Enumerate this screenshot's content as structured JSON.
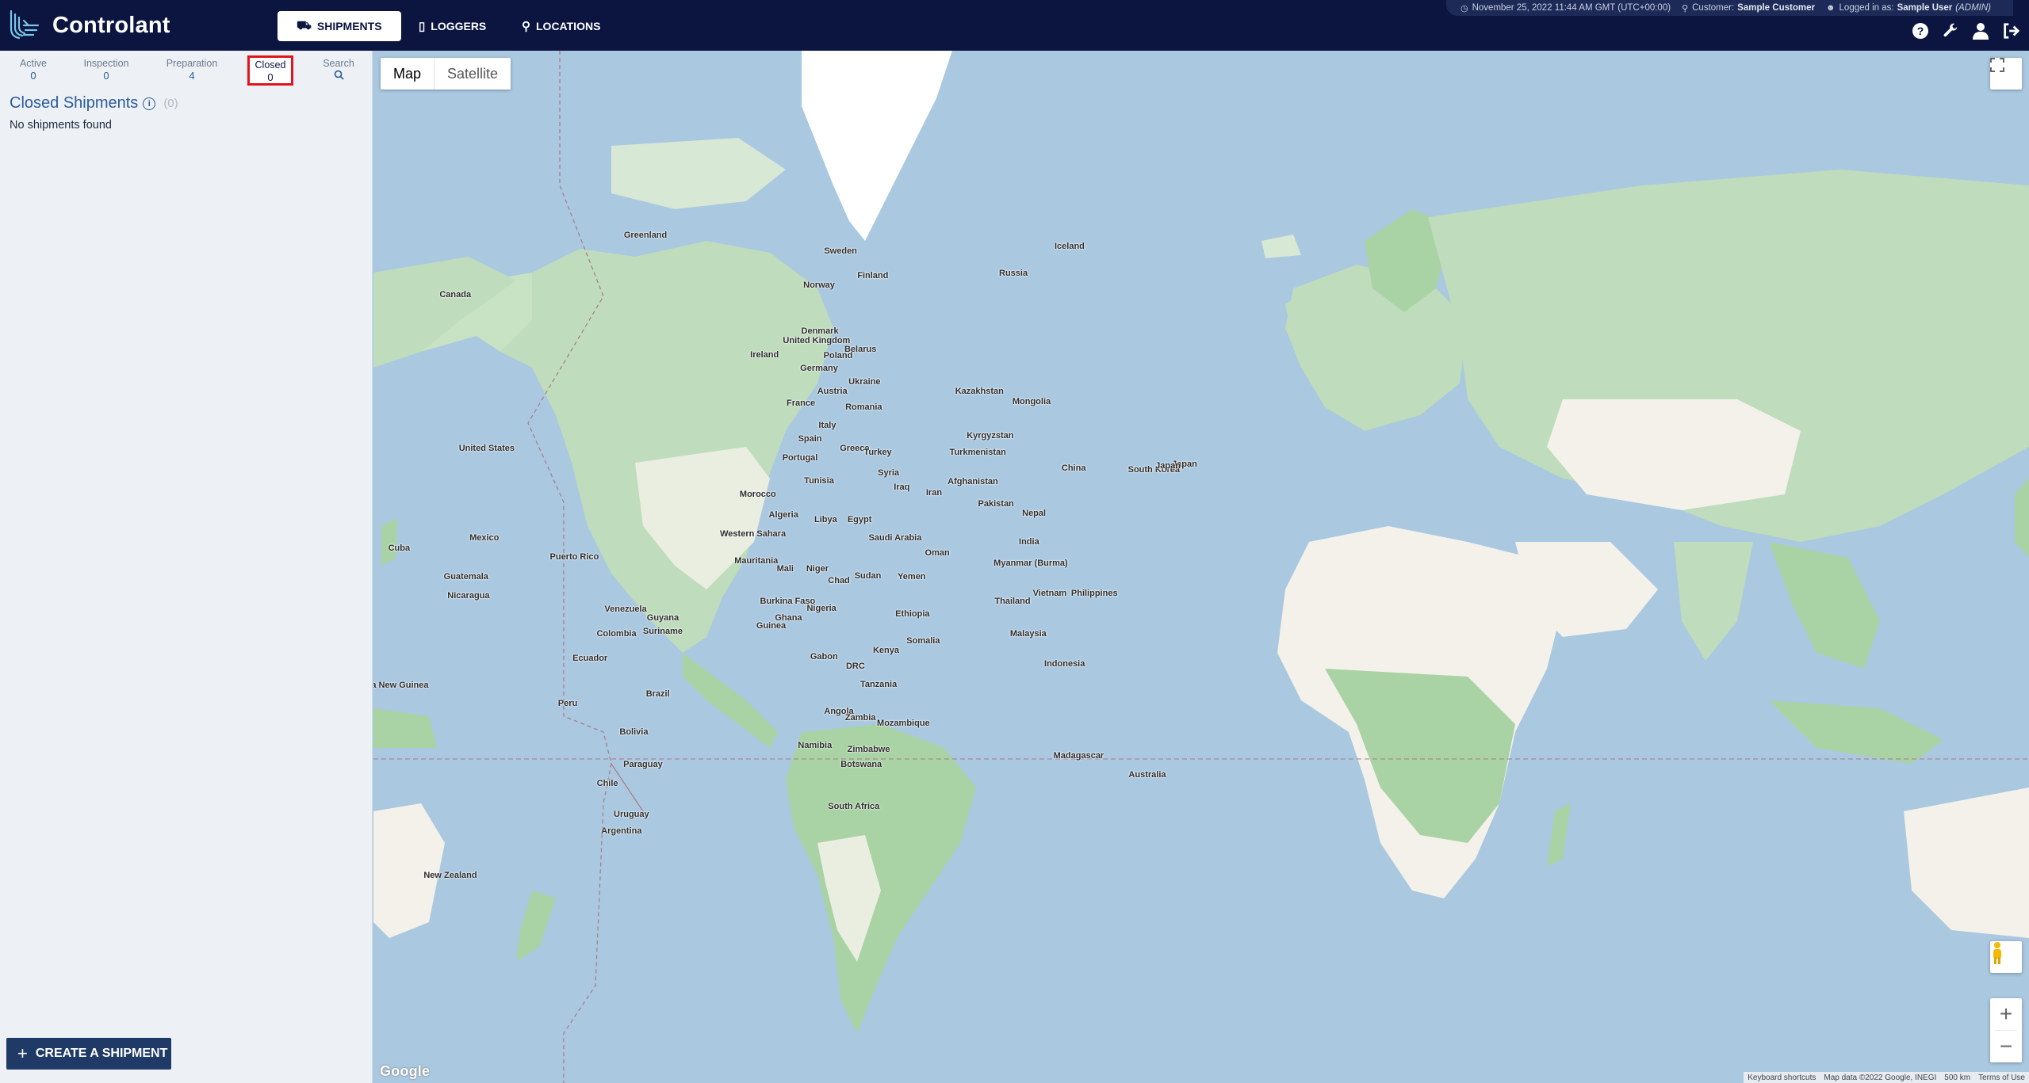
{
  "brand": {
    "name": "Controlant",
    "logo_icon": "controlant-logo"
  },
  "nav": {
    "tabs": [
      {
        "label": "SHIPMENTS",
        "icon": "shipments-icon",
        "active": true
      },
      {
        "label": "LOGGERS",
        "icon": "logger-icon",
        "active": false
      },
      {
        "label": "LOCATIONS",
        "icon": "location-pin-icon",
        "active": false
      }
    ]
  },
  "infobar": {
    "datetime": "November 25, 2022 11:44 AM GMT (UTC+00:00)",
    "customer_label": "Customer:",
    "customer_name": "Sample Customer",
    "logged_label": "Logged in as:",
    "user_name": "Sample User",
    "user_role": "(ADMIN)"
  },
  "sidebar": {
    "categories": [
      {
        "label": "Active",
        "count": "0"
      },
      {
        "label": "Inspection",
        "count": "0"
      },
      {
        "label": "Preparation",
        "count": "4"
      },
      {
        "label": "Closed",
        "count": "0",
        "selected": true
      },
      {
        "label": "Search",
        "icon": "search-icon"
      }
    ],
    "list_title": "Closed Shipments",
    "list_count": "(0)",
    "empty_text": "No shipments found",
    "create_button": "CREATE A SHIPMENT"
  },
  "map": {
    "type_buttons": [
      "Map",
      "Satellite"
    ],
    "selected_type": "Map",
    "google": "Google",
    "attribution": [
      "Keyboard shortcuts",
      "Map data ©2022 Google, INEGI",
      "500 km",
      "Terms of Use"
    ],
    "labels": [
      "Greenland",
      "Iceland",
      "Canada",
      "United States",
      "Mexico",
      "Cuba",
      "Puerto Rico",
      "Guatemala",
      "Nicaragua",
      "Venezuela",
      "Guyana",
      "Suriname",
      "Colombia",
      "Ecuador",
      "Peru",
      "Brazil",
      "Bolivia",
      "Paraguay",
      "Chile",
      "Argentina",
      "Uruguay",
      "Sweden",
      "Finland",
      "Norway",
      "Russia",
      "United Kingdom",
      "Ireland",
      "Denmark",
      "Poland",
      "Belarus",
      "Germany",
      "Ukraine",
      "France",
      "Austria",
      "Romania",
      "Kazakhstan",
      "Mongolia",
      "Italy",
      "Spain",
      "Portugal",
      "Greece",
      "Turkey",
      "Kyrgyzstan",
      "Turkmenistan",
      "Tunisia",
      "Syria",
      "Afghanistan",
      "Iraq",
      "Iran",
      "China",
      "South Korea",
      "Japan",
      "Pakistan",
      "Nepal",
      "Morocco",
      "Algeria",
      "Libya",
      "Egypt",
      "Western Sahara",
      "Saudi Arabia",
      "India",
      "Oman",
      "Mauritania",
      "Mali",
      "Niger",
      "Chad",
      "Sudan",
      "Yemen",
      "Myanmar (Burma)",
      "Thailand",
      "Burkina Faso",
      "Nigeria",
      "Ethiopia",
      "Vietnam",
      "Philippines",
      "Guinea",
      "Ghana",
      "Malaysia",
      "Somalia",
      "Kenya",
      "Gabon",
      "DRC",
      "Indonesia",
      "Tanzania",
      "Papua New Guinea",
      "Angola",
      "Zambia",
      "Mozambique",
      "Namibia",
      "Zimbabwe",
      "Botswana",
      "Madagascar",
      "South Africa",
      "Australia",
      "New Zealand",
      "Japan "
    ]
  },
  "colors": {
    "navy": "#0b1540",
    "accent": "#2c5b9c",
    "selected_border": "#e0141b",
    "water": "#aac8e0",
    "land": "#cfe6cc"
  }
}
